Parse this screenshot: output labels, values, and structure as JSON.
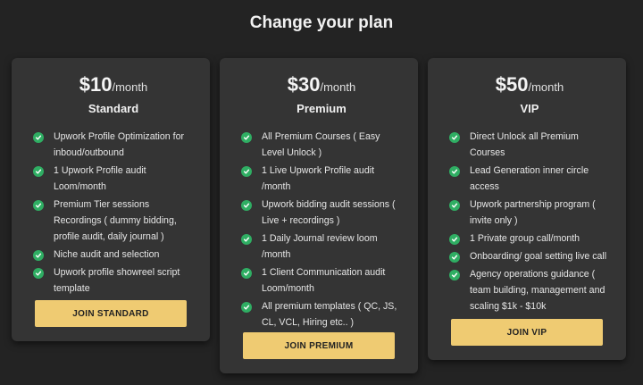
{
  "page": {
    "title": "Change your plan"
  },
  "plans": [
    {
      "price": "$10",
      "period": "/month",
      "name": "Standard",
      "features": [
        "Upwork Profile Optimization for inboud/outbound",
        "1 Upwork Profile audit Loom/month",
        "Premium Tier sessions Recordings ( dummy bidding, profile audit, daily journal )",
        "Niche audit and selection",
        "Upwork profile showreel script template"
      ],
      "cta": "JOIN STANDARD"
    },
    {
      "price": "$30",
      "period": "/month",
      "name": "Premium",
      "features": [
        "All Premium Courses ( Easy Level Unlock )",
        "1 Live Upwork Profile audit /month",
        "Upwork bidding audit sessions ( Live + recordings )",
        "1 Daily Journal review loom /month",
        "1 Client Communication audit Loom/month",
        "All premium templates ( QC, JS, CL, VCL, Hiring etc.. )"
      ],
      "cta": "JOIN PREMIUM"
    },
    {
      "price": "$50",
      "period": "/month",
      "name": "VIP",
      "features": [
        "Direct Unlock all Premium Courses",
        "Lead Generation inner circle access",
        "Upwork partnership program ( invite only )",
        "1 Private group call/month",
        "Onboarding/ goal setting live call",
        "Agency operations guidance ( team building, management and scaling $1k - $10k"
      ],
      "cta": "JOIN VIP"
    }
  ],
  "icons": {
    "feature_bullet": "check-circle-icon"
  },
  "colors": {
    "background": "#232323",
    "card": "#343434",
    "check": "#2fae63",
    "button": "#efcb72"
  }
}
